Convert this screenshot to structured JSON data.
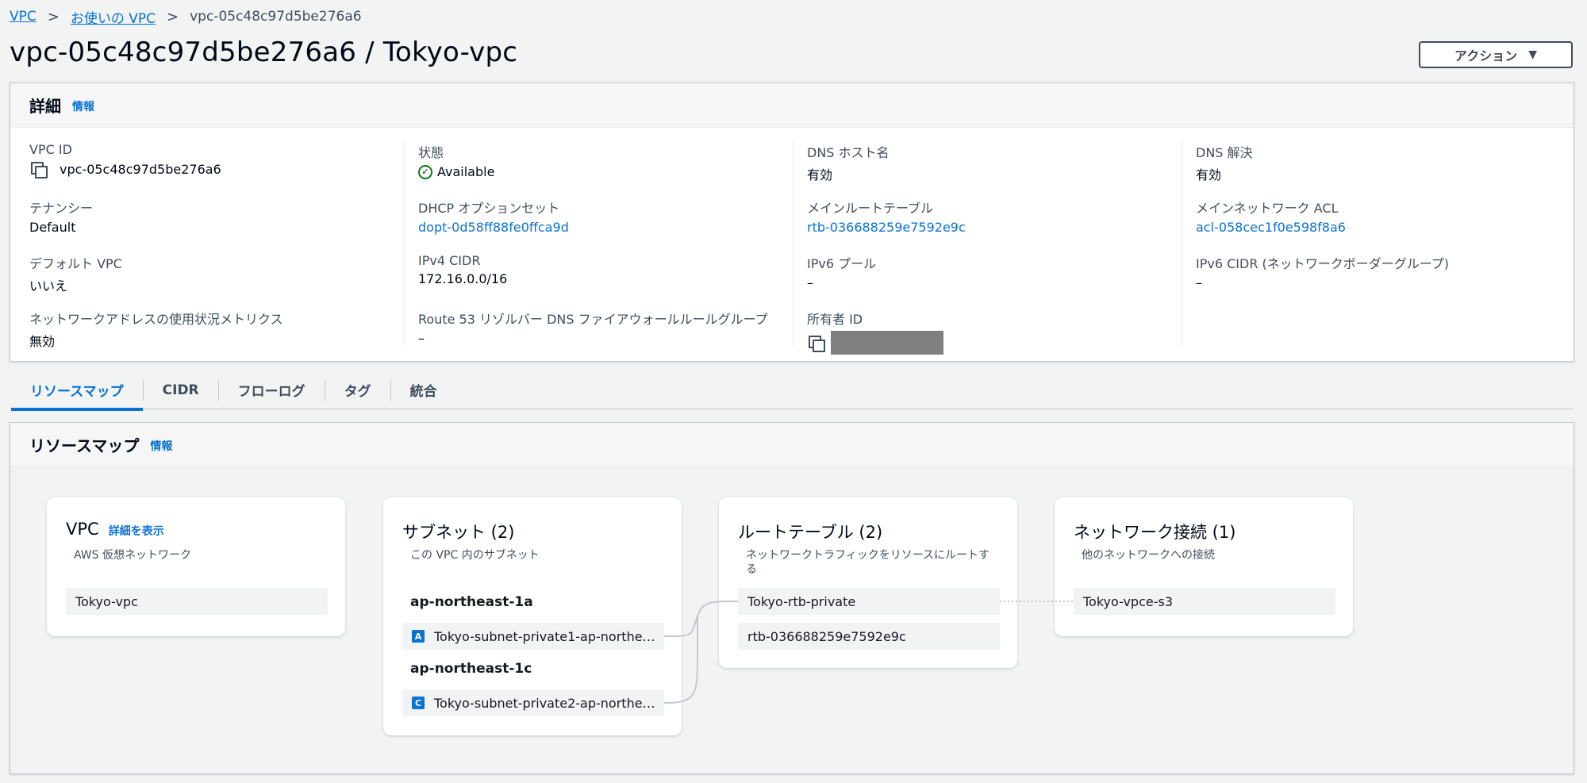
{
  "breadcrumb": {
    "vpc": "VPC",
    "your_vpcs": "お使いの VPC",
    "current": "vpc-05c48c97d5be276a6",
    "separator": ">"
  },
  "page_title": "vpc-05c48c97d5be276a6 / Tokyo-vpc",
  "actions": {
    "label": "アクション",
    "caret": "▼"
  },
  "details": {
    "title": "詳細",
    "info": "情報",
    "fields": {
      "vpc_id_label": "VPC ID",
      "vpc_id_value": "vpc-05c48c97d5be276a6",
      "state_label": "状態",
      "state_value": "Available",
      "dns_hostnames_label": "DNS ホスト名",
      "dns_hostnames_value": "有効",
      "dns_resolution_label": "DNS 解決",
      "dns_resolution_value": "有効",
      "tenancy_label": "テナンシー",
      "tenancy_value": "Default",
      "dhcp_label": "DHCP オプションセット",
      "dhcp_value": "dopt-0d58ff88fe0ffca9d",
      "main_rt_label": "メインルートテーブル",
      "main_rt_value": "rtb-036688259e7592e9c",
      "main_acl_label": "メインネットワーク ACL",
      "main_acl_value": "acl-058cec1f0e598f8a6",
      "default_vpc_label": "デフォルト VPC",
      "default_vpc_value": "いいえ",
      "ipv4_cidr_label": "IPv4 CIDR",
      "ipv4_cidr_value": "172.16.0.0/16",
      "ipv6_pool_label": "IPv6 プール",
      "ipv6_pool_value": "–",
      "ipv6_cidr_label": "IPv6 CIDR (ネットワークボーダーグループ)",
      "ipv6_cidr_value": "–",
      "net_metrics_label": "ネットワークアドレスの使用状況メトリクス",
      "net_metrics_value": "無効",
      "route53_label": "Route 53 リゾルバー DNS ファイアウォールルールグループ",
      "route53_value": "–",
      "owner_label": "所有者 ID"
    }
  },
  "tabs": [
    "リソースマップ",
    "CIDR",
    "フローログ",
    "タグ",
    "統合"
  ],
  "resource_map": {
    "title": "リソースマップ",
    "info": "情報",
    "vpc_card": {
      "title": "VPC",
      "detail_link": "詳細を表示",
      "subtitle": "AWS 仮想ネットワーク",
      "item": "Tokyo-vpc"
    },
    "subnet_card": {
      "title": "サブネット (2)",
      "subtitle": "この VPC 内のサブネット",
      "az1": "ap-northeast-1a",
      "az1_badge": "A",
      "az1_subnet": "Tokyo-subnet-private1-ap-northe…",
      "az2": "ap-northeast-1c",
      "az2_badge": "C",
      "az2_subnet": "Tokyo-subnet-private2-ap-northe…"
    },
    "rt_card": {
      "title": "ルートテーブル (2)",
      "subtitle": "ネットワークトラフィックをリソースにルートする",
      "item1": "Tokyo-rtb-private",
      "item2": "rtb-036688259e7592e9c"
    },
    "net_card": {
      "title": "ネットワーク接続 (1)",
      "subtitle": "他のネットワークへの接続",
      "item": "Tokyo-vpce-s3"
    }
  },
  "colors": {
    "link": "#0972d3",
    "success": "#037f0c",
    "background": "#f2f3f3"
  },
  "icons": [
    "chevron-right-icon",
    "copy-icon",
    "check-circle-icon",
    "caret-down-icon"
  ]
}
